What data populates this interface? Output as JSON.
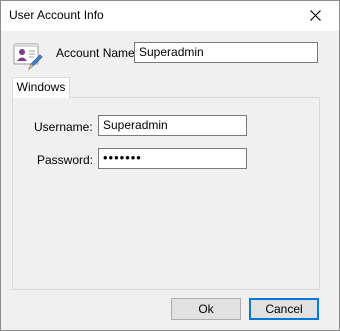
{
  "window": {
    "title": "User Account Info"
  },
  "account": {
    "label": "Account Name:",
    "value": "Superadmin",
    "icon": "user-card-icon"
  },
  "tabs": [
    {
      "label": "Windows",
      "selected": true
    }
  ],
  "windows_panel": {
    "username_label": "Username:",
    "username_value": "Superadmin",
    "password_label": "Password:",
    "password_value": "•••••••"
  },
  "buttons": {
    "ok": "Ok",
    "cancel": "Cancel"
  },
  "colors": {
    "focus_border": "#0078d7",
    "window_bg": "#f0f0f0",
    "titlebar_bg": "#ffffff"
  }
}
